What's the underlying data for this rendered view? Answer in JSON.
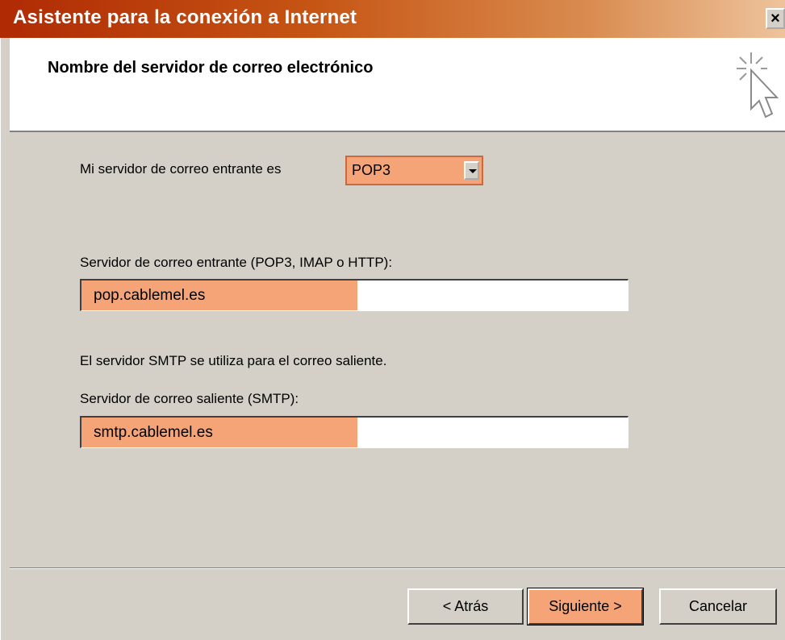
{
  "window": {
    "title": "Asistente para la conexión a Internet",
    "close_label": "×"
  },
  "header": {
    "title": "Nombre del servidor de correo electrónico",
    "icon": "wizard-cursor-icon"
  },
  "form": {
    "incoming_type_label": "Mi servidor de correo entrante es",
    "incoming_type_value": "POP3",
    "incoming_server_label": "Servidor de correo entrante (POP3, IMAP o HTTP):",
    "incoming_server_value": "pop.cablemel.es",
    "smtp_info": "El servidor SMTP se utiliza para el correo saliente.",
    "outgoing_server_label": "Servidor de correo saliente (SMTP):",
    "outgoing_server_value": "smtp.cablemel.es"
  },
  "buttons": {
    "back": "< Atrás",
    "next": "Siguiente >",
    "cancel": "Cancelar"
  },
  "colors": {
    "title_gradient_start": "#b02a04",
    "highlight": "#f4a477",
    "dialog_bg": "#d4d0c8"
  }
}
